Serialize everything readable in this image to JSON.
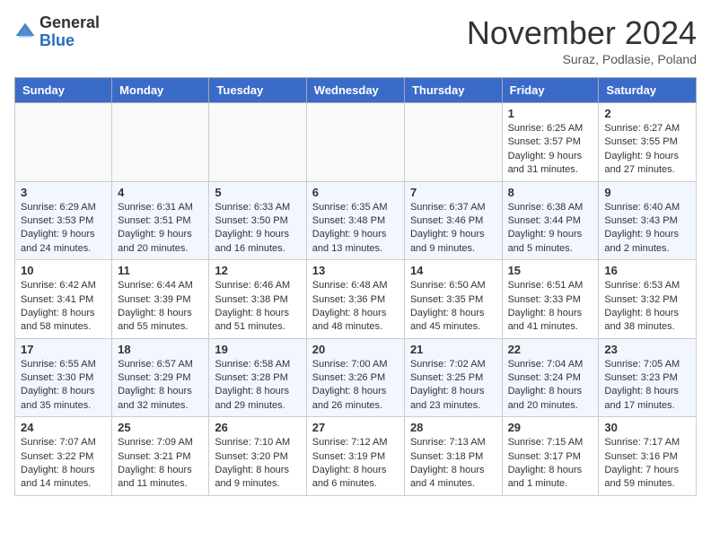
{
  "header": {
    "logo_general": "General",
    "logo_blue": "Blue",
    "month_title": "November 2024",
    "subtitle": "Suraz, Podlasie, Poland"
  },
  "weekdays": [
    "Sunday",
    "Monday",
    "Tuesday",
    "Wednesday",
    "Thursday",
    "Friday",
    "Saturday"
  ],
  "weeks": [
    [
      {
        "day": "",
        "info": ""
      },
      {
        "day": "",
        "info": ""
      },
      {
        "day": "",
        "info": ""
      },
      {
        "day": "",
        "info": ""
      },
      {
        "day": "",
        "info": ""
      },
      {
        "day": "1",
        "info": "Sunrise: 6:25 AM\nSunset: 3:57 PM\nDaylight: 9 hours and 31 minutes."
      },
      {
        "day": "2",
        "info": "Sunrise: 6:27 AM\nSunset: 3:55 PM\nDaylight: 9 hours and 27 minutes."
      }
    ],
    [
      {
        "day": "3",
        "info": "Sunrise: 6:29 AM\nSunset: 3:53 PM\nDaylight: 9 hours and 24 minutes."
      },
      {
        "day": "4",
        "info": "Sunrise: 6:31 AM\nSunset: 3:51 PM\nDaylight: 9 hours and 20 minutes."
      },
      {
        "day": "5",
        "info": "Sunrise: 6:33 AM\nSunset: 3:50 PM\nDaylight: 9 hours and 16 minutes."
      },
      {
        "day": "6",
        "info": "Sunrise: 6:35 AM\nSunset: 3:48 PM\nDaylight: 9 hours and 13 minutes."
      },
      {
        "day": "7",
        "info": "Sunrise: 6:37 AM\nSunset: 3:46 PM\nDaylight: 9 hours and 9 minutes."
      },
      {
        "day": "8",
        "info": "Sunrise: 6:38 AM\nSunset: 3:44 PM\nDaylight: 9 hours and 5 minutes."
      },
      {
        "day": "9",
        "info": "Sunrise: 6:40 AM\nSunset: 3:43 PM\nDaylight: 9 hours and 2 minutes."
      }
    ],
    [
      {
        "day": "10",
        "info": "Sunrise: 6:42 AM\nSunset: 3:41 PM\nDaylight: 8 hours and 58 minutes."
      },
      {
        "day": "11",
        "info": "Sunrise: 6:44 AM\nSunset: 3:39 PM\nDaylight: 8 hours and 55 minutes."
      },
      {
        "day": "12",
        "info": "Sunrise: 6:46 AM\nSunset: 3:38 PM\nDaylight: 8 hours and 51 minutes."
      },
      {
        "day": "13",
        "info": "Sunrise: 6:48 AM\nSunset: 3:36 PM\nDaylight: 8 hours and 48 minutes."
      },
      {
        "day": "14",
        "info": "Sunrise: 6:50 AM\nSunset: 3:35 PM\nDaylight: 8 hours and 45 minutes."
      },
      {
        "day": "15",
        "info": "Sunrise: 6:51 AM\nSunset: 3:33 PM\nDaylight: 8 hours and 41 minutes."
      },
      {
        "day": "16",
        "info": "Sunrise: 6:53 AM\nSunset: 3:32 PM\nDaylight: 8 hours and 38 minutes."
      }
    ],
    [
      {
        "day": "17",
        "info": "Sunrise: 6:55 AM\nSunset: 3:30 PM\nDaylight: 8 hours and 35 minutes."
      },
      {
        "day": "18",
        "info": "Sunrise: 6:57 AM\nSunset: 3:29 PM\nDaylight: 8 hours and 32 minutes."
      },
      {
        "day": "19",
        "info": "Sunrise: 6:58 AM\nSunset: 3:28 PM\nDaylight: 8 hours and 29 minutes."
      },
      {
        "day": "20",
        "info": "Sunrise: 7:00 AM\nSunset: 3:26 PM\nDaylight: 8 hours and 26 minutes."
      },
      {
        "day": "21",
        "info": "Sunrise: 7:02 AM\nSunset: 3:25 PM\nDaylight: 8 hours and 23 minutes."
      },
      {
        "day": "22",
        "info": "Sunrise: 7:04 AM\nSunset: 3:24 PM\nDaylight: 8 hours and 20 minutes."
      },
      {
        "day": "23",
        "info": "Sunrise: 7:05 AM\nSunset: 3:23 PM\nDaylight: 8 hours and 17 minutes."
      }
    ],
    [
      {
        "day": "24",
        "info": "Sunrise: 7:07 AM\nSunset: 3:22 PM\nDaylight: 8 hours and 14 minutes."
      },
      {
        "day": "25",
        "info": "Sunrise: 7:09 AM\nSunset: 3:21 PM\nDaylight: 8 hours and 11 minutes."
      },
      {
        "day": "26",
        "info": "Sunrise: 7:10 AM\nSunset: 3:20 PM\nDaylight: 8 hours and 9 minutes."
      },
      {
        "day": "27",
        "info": "Sunrise: 7:12 AM\nSunset: 3:19 PM\nDaylight: 8 hours and 6 minutes."
      },
      {
        "day": "28",
        "info": "Sunrise: 7:13 AM\nSunset: 3:18 PM\nDaylight: 8 hours and 4 minutes."
      },
      {
        "day": "29",
        "info": "Sunrise: 7:15 AM\nSunset: 3:17 PM\nDaylight: 8 hours and 1 minute."
      },
      {
        "day": "30",
        "info": "Sunrise: 7:17 AM\nSunset: 3:16 PM\nDaylight: 7 hours and 59 minutes."
      }
    ]
  ]
}
